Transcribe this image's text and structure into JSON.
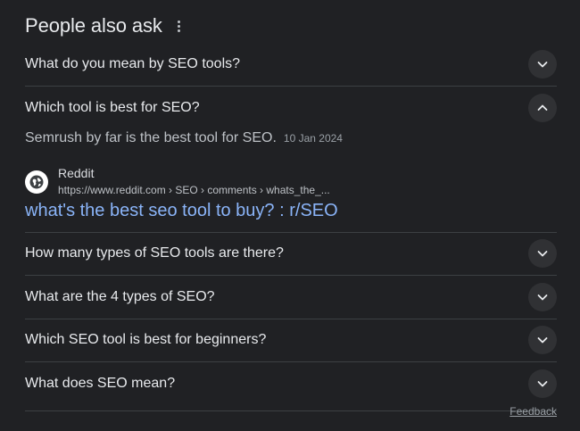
{
  "header": {
    "title": "People also ask",
    "more_icon": "more-vert-icon"
  },
  "questions": [
    {
      "text": "What do you mean by SEO tools?",
      "expanded": false,
      "icon": "chevron-down-icon"
    },
    {
      "text": "Which tool is best for SEO?",
      "expanded": true,
      "icon": "chevron-up-icon"
    },
    {
      "text": "How many types of SEO tools are there?",
      "expanded": false,
      "icon": "chevron-down-icon"
    },
    {
      "text": "What are the 4 types of SEO?",
      "expanded": false,
      "icon": "chevron-down-icon"
    },
    {
      "text": "Which SEO tool is best for beginners?",
      "expanded": false,
      "icon": "chevron-down-icon"
    },
    {
      "text": "What does SEO mean?",
      "expanded": false,
      "icon": "chevron-down-icon"
    }
  ],
  "expanded_answer": {
    "snippet": "Semrush by far is the best tool for SEO.",
    "date": "10 Jan 2024",
    "source_name": "Reddit",
    "source_url": "https://www.reddit.com › SEO › comments › whats_the_...",
    "source_icon": "globe-icon",
    "link_title": "what's the best seo tool to buy? : r/SEO"
  },
  "footer": {
    "feedback_label": "Feedback"
  },
  "colors": {
    "background": "#202124",
    "text": "#e8eaed",
    "link": "#8ab4f8",
    "divider": "#3c4043",
    "chevron_bg": "#303134"
  }
}
